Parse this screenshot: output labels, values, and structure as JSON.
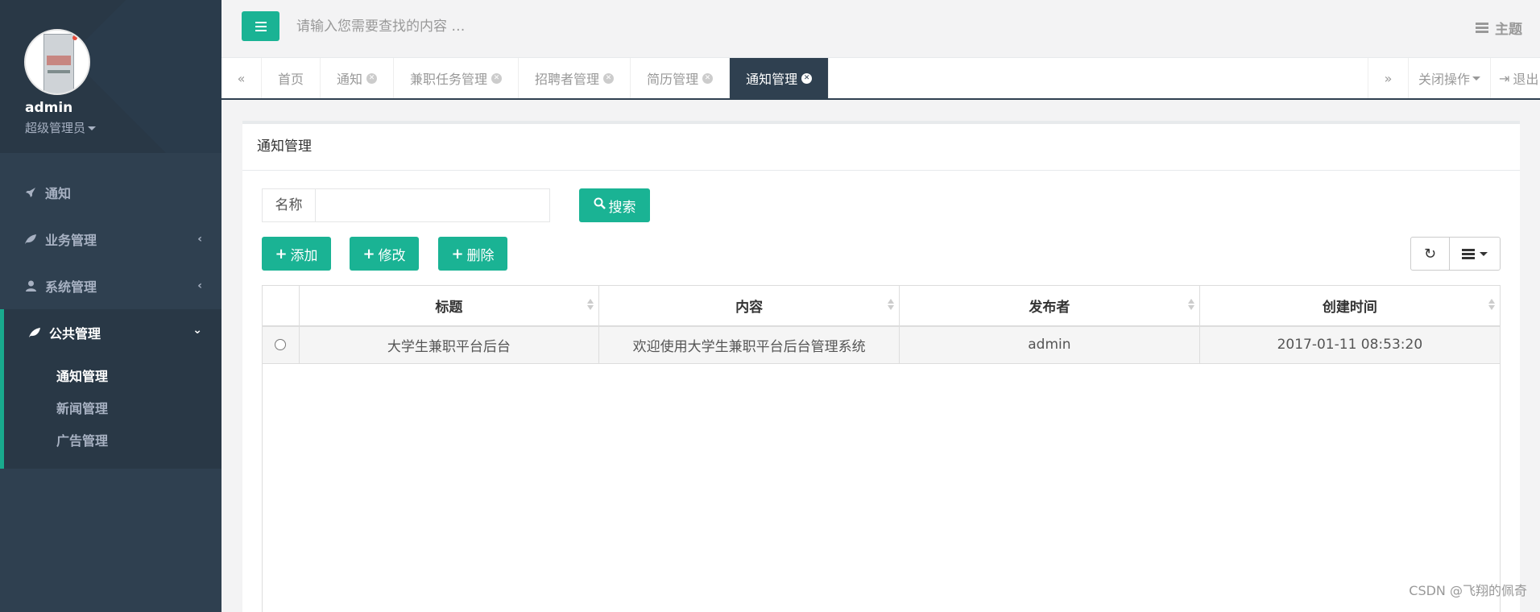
{
  "profile": {
    "name": "admin",
    "role": "超级管理员"
  },
  "sidebar": {
    "items": [
      {
        "label": "通知",
        "icon": "rocket-icon"
      },
      {
        "label": "业务管理",
        "icon": "leaf-icon"
      },
      {
        "label": "系统管理",
        "icon": "user-icon"
      },
      {
        "label": "公共管理",
        "icon": "leaf-icon"
      }
    ],
    "sub_items": [
      "通知管理",
      "新闻管理",
      "广告管理"
    ]
  },
  "topbar": {
    "search_placeholder": "请输入您需要查找的内容 …",
    "theme_label": "主题"
  },
  "tabs": [
    "首页",
    "通知",
    "兼职任务管理",
    "招聘者管理",
    "简历管理",
    "通知管理"
  ],
  "tab_controls": {
    "close_ops": "关闭操作",
    "logout": "退出"
  },
  "panel": {
    "title": "通知管理",
    "search_label": "名称",
    "search_value": "",
    "search_button": "搜索",
    "add_button": "添加",
    "edit_button": "修改",
    "delete_button": "删除"
  },
  "table": {
    "headers": [
      "标题",
      "内容",
      "发布者",
      "创建时间"
    ],
    "rows": [
      [
        "大学生兼职平台后台",
        "欢迎使用大学生兼职平台后台管理系统",
        "admin",
        "2017-01-11 08:53:20"
      ]
    ]
  },
  "watermark": "CSDN @飞翔的佩奇",
  "colors": {
    "sidebar": "#2f4050",
    "accent": "#1ab394",
    "active_tab": "#2f4050"
  }
}
